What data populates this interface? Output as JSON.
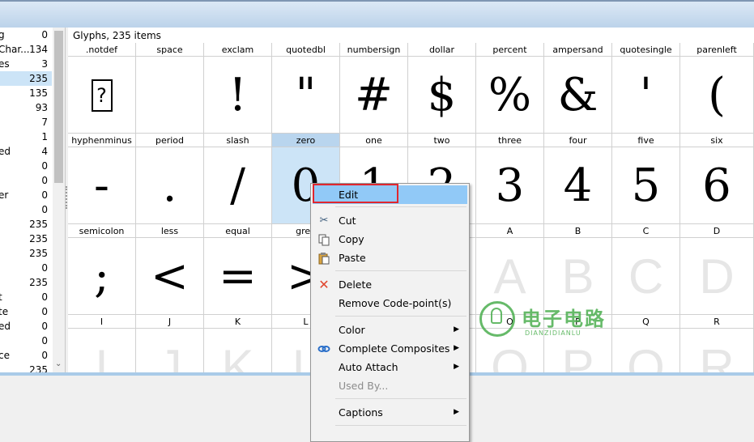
{
  "glyph_panel": {
    "title": "Glyphs, 235 items"
  },
  "left_list": [
    {
      "name": "g",
      "count": "0"
    },
    {
      "name": "Char...",
      "count": "134"
    },
    {
      "name": "es",
      "count": "3"
    },
    {
      "name": "",
      "count": "235"
    },
    {
      "name": "",
      "count": "135"
    },
    {
      "name": "",
      "count": "93"
    },
    {
      "name": "",
      "count": "7"
    },
    {
      "name": "",
      "count": "1"
    },
    {
      "name": "ed",
      "count": "4"
    },
    {
      "name": "",
      "count": "0"
    },
    {
      "name": "",
      "count": "0"
    },
    {
      "name": "er",
      "count": "0"
    },
    {
      "name": "",
      "count": "0"
    },
    {
      "name": "",
      "count": "235"
    },
    {
      "name": "",
      "count": "235"
    },
    {
      "name": "",
      "count": "235"
    },
    {
      "name": "",
      "count": "0"
    },
    {
      "name": "",
      "count": "235"
    },
    {
      "name": "t",
      "count": "0"
    },
    {
      "name": "te",
      "count": "0"
    },
    {
      "name": "ed",
      "count": "0"
    },
    {
      "name": "",
      "count": "0"
    },
    {
      "name": "ce",
      "count": "0"
    },
    {
      "name": "",
      "count": "235"
    }
  ],
  "glyph_rows": [
    [
      {
        "name": ".notdef",
        "glyph": "?"
      },
      {
        "name": "space",
        "glyph": ""
      },
      {
        "name": "exclam",
        "glyph": "!"
      },
      {
        "name": "quotedbl",
        "glyph": "\""
      },
      {
        "name": "numbersign",
        "glyph": "#"
      },
      {
        "name": "dollar",
        "glyph": "$"
      },
      {
        "name": "percent",
        "glyph": "%"
      },
      {
        "name": "ampersand",
        "glyph": "&"
      },
      {
        "name": "quotesingle",
        "glyph": "'"
      },
      {
        "name": "parenleft",
        "glyph": "("
      }
    ],
    [
      {
        "name": "hyphenminus",
        "glyph": "-"
      },
      {
        "name": "period",
        "glyph": "."
      },
      {
        "name": "slash",
        "glyph": "/"
      },
      {
        "name": "zero",
        "glyph": "0"
      },
      {
        "name": "one",
        "glyph": "1"
      },
      {
        "name": "two",
        "glyph": "2"
      },
      {
        "name": "three",
        "glyph": "3"
      },
      {
        "name": "four",
        "glyph": "4"
      },
      {
        "name": "five",
        "glyph": "5"
      },
      {
        "name": "six",
        "glyph": "6"
      }
    ],
    [
      {
        "name": "semicolon",
        "glyph": ";"
      },
      {
        "name": "less",
        "glyph": "<"
      },
      {
        "name": "equal",
        "glyph": "="
      },
      {
        "name": "grea",
        "glyph": ">"
      },
      {
        "name": "",
        "glyph": ""
      },
      {
        "name": "",
        "glyph": ""
      },
      {
        "name": "A",
        "glyph": "A"
      },
      {
        "name": "B",
        "glyph": "B"
      },
      {
        "name": "C",
        "glyph": "C"
      },
      {
        "name": "D",
        "glyph": "D"
      }
    ],
    [
      {
        "name": "I",
        "glyph": "I"
      },
      {
        "name": "J",
        "glyph": "J"
      },
      {
        "name": "K",
        "glyph": "K"
      },
      {
        "name": "L",
        "glyph": "L"
      },
      {
        "name": "",
        "glyph": ""
      },
      {
        "name": "",
        "glyph": ""
      },
      {
        "name": "O",
        "glyph": "O"
      },
      {
        "name": "P",
        "glyph": "P"
      },
      {
        "name": "Q",
        "glyph": "Q"
      },
      {
        "name": "R",
        "glyph": "R"
      }
    ]
  ],
  "selected_glyph": "zero",
  "context_menu": {
    "edit": "Edit",
    "cut": "Cut",
    "copy": "Copy",
    "paste": "Paste",
    "delete": "Delete",
    "remove_code_point": "Remove Code-point(s)",
    "color": "Color",
    "complete_composites": "Complete Composites",
    "auto_attach": "Auto Attach",
    "used_by": "Used By...",
    "captions": "Captions"
  },
  "watermark": {
    "cn": "电子电路",
    "en": "DIANZIDIANLU"
  },
  "colors": {
    "selection": "#cce4f7",
    "menu_highlight": "#91c9f7",
    "callout": "#e0262e"
  }
}
